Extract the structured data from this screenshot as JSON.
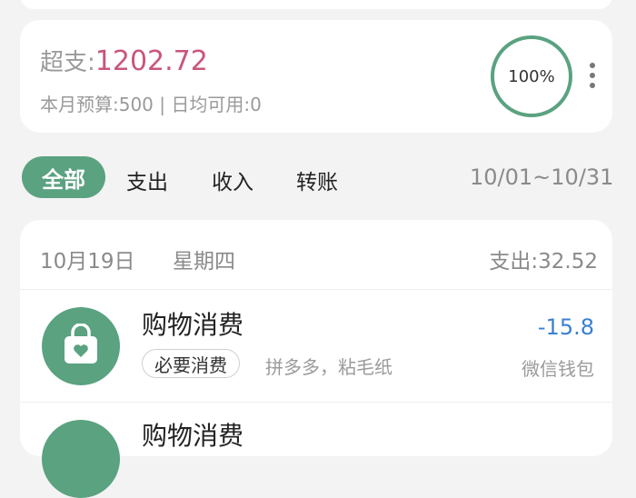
{
  "budget": {
    "overspend_label": "超支:",
    "overspend_amount": "1202.72",
    "summary": "本月预算:500 | 日均可用:0",
    "progress_text": "100%",
    "progress_fraction": 1.0,
    "ring_color": "#5aa280",
    "overspend_color": "#c9567a"
  },
  "filters": {
    "tabs": [
      "全部",
      "支出",
      "收入",
      "转账"
    ],
    "active": "全部",
    "date_range": "10/01~10/31",
    "accent": "#5aa280"
  },
  "day_group": {
    "date": "10月19日",
    "weekday": "星期四",
    "total": "支出:32.52"
  },
  "transactions": [
    {
      "category": "购物消费",
      "icon": "shopping-bag-heart-icon",
      "tag": "必要消费",
      "note": "拼多多，粘毛纸",
      "amount": "-15.8",
      "account": "微信钱包",
      "amount_color": "#3c7fd0"
    },
    {
      "category": "购物消费",
      "icon": "shopping-bag-heart-icon"
    }
  ]
}
